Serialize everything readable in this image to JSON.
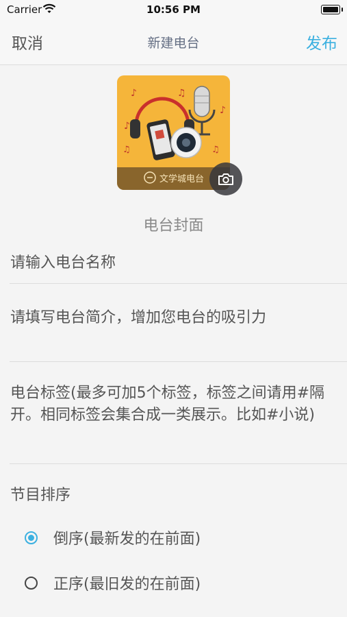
{
  "status_bar": {
    "carrier": "Carrier",
    "time": "10:56 PM",
    "icons": [
      "wifi-icon",
      "battery-icon"
    ]
  },
  "nav": {
    "cancel_label": "取消",
    "title": "新建电台",
    "publish_label": "发布"
  },
  "cover": {
    "label": "电台封面",
    "image_icons": [
      "headphones-icon",
      "phone-icon",
      "microphone-icon",
      "speaker-icon"
    ],
    "banner_text": "文学城电台",
    "camera_icon": "camera-icon"
  },
  "form": {
    "name_placeholder": "请输入电台名称",
    "intro_placeholder": "请填写电台简介，增加您电台的吸引力",
    "tags_placeholder": "电台标签(最多可加5个标签，标签之间请用#隔开。相同标签会集合成一类展示。比如#小说)"
  },
  "order": {
    "label": "节目排序",
    "options": [
      {
        "label": "倒序(最新发的在前面)",
        "selected": true
      },
      {
        "label": "正序(最旧发的在前面)",
        "selected": false
      }
    ]
  },
  "colors": {
    "accent": "#3bb0e0",
    "cover_bg": "#f5b53a",
    "background": "#f4f4f4"
  }
}
